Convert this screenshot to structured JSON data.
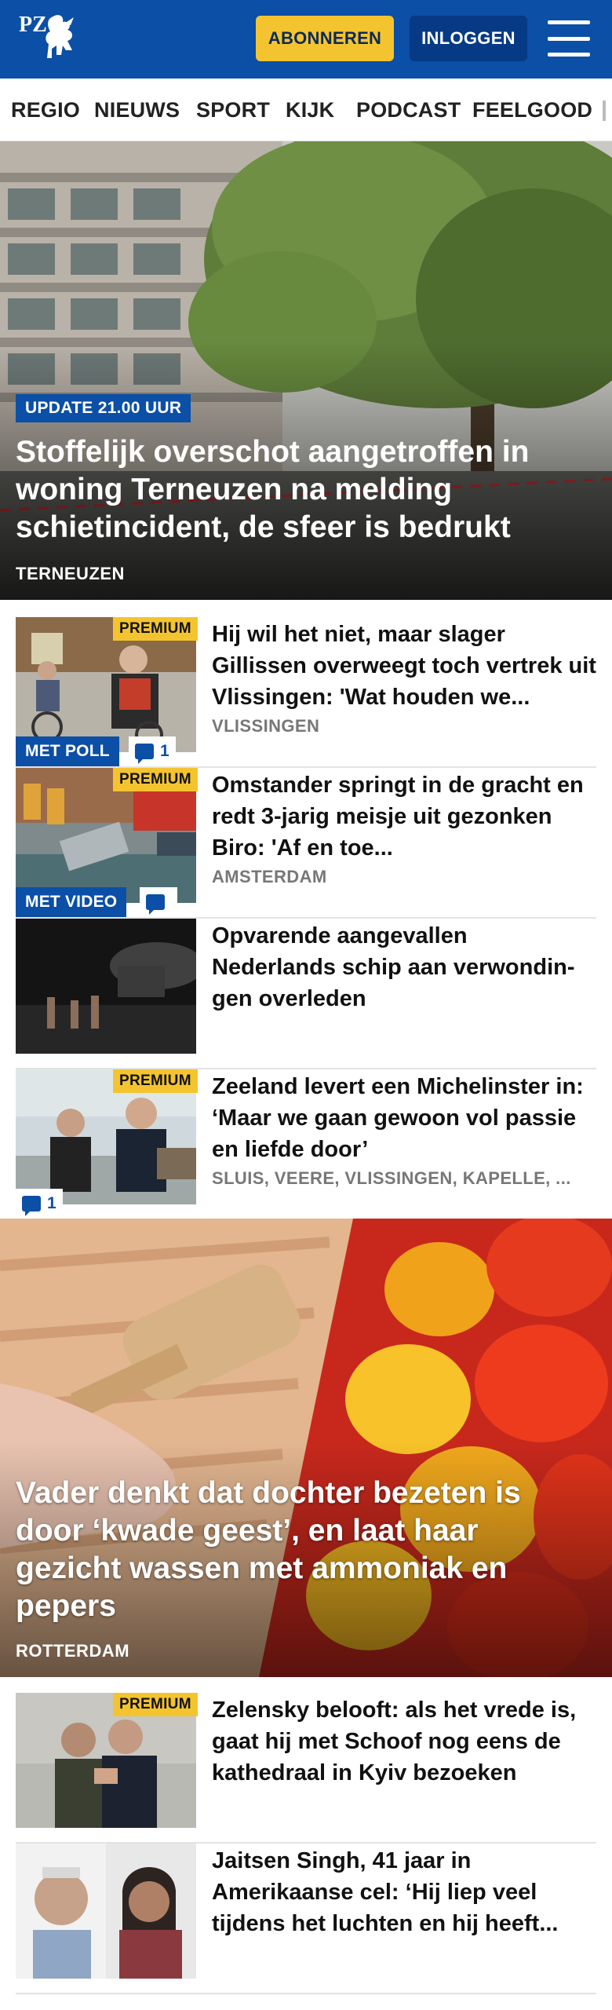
{
  "header": {
    "logo_text": "PZC",
    "subscribe_label": "ABONNEREN",
    "login_label": "INLOGGEN",
    "menu_icon": "hamburger-icon",
    "brand_color": "#0b4fa6",
    "accent_color": "#f4c430"
  },
  "nav": {
    "items": [
      "REGIO",
      "NIEUWS",
      "SPORT",
      "KIJK",
      "PODCAST",
      "FEELGOOD"
    ]
  },
  "hero": {
    "badge": "UPDATE 21.00 UUR",
    "title": "Stoffelijk overschot aangetroffen in woning Terneuzen na melding schietincident, de sfeer is bedrukt",
    "location": "TERNEUZEN"
  },
  "articles": [
    {
      "premium": "PREMIUM",
      "tag": "MET POLL",
      "comments": "1",
      "title": "Hij wil het niet, maar slager Gillissen overweegt toch vertrek uit Vlissingen: 'Wat houden we...",
      "location": "VLISSINGEN"
    },
    {
      "premium": "PREMIUM",
      "tag": "MET VIDEO",
      "comments": "",
      "title": "Omstander springt in de gracht en redt 3-jarig meisje uit gezonken Biro: 'Af en toe...",
      "location": "AMSTERDAM"
    },
    {
      "title": "Opvarende aangevallen Nederlands schip aan verwondin-gen overleden"
    },
    {
      "premium": "PREMIUM",
      "comments": "1",
      "title": "Zeeland levert een Michelinster in: ‘Maar we gaan gewoon vol passie en liefde door’",
      "location": "SLUIS, VEERE, VLISSINGEN, KAPELLE, ..."
    }
  ],
  "feature": {
    "title": "Vader denkt dat dochter bezeten is door ‘kwade geest’, en laat haar gezicht wassen met ammoniak en pepers",
    "location": "ROTTERDAM"
  },
  "articles2": [
    {
      "premium": "PREMIUM",
      "title": "Zelensky belooft: als het vrede is, gaat hij met Schoof nog eens de kathedraal in Kyiv bezoeken"
    },
    {
      "title": "Jaitsen Singh, 41 jaar in Amerikaanse cel: ‘Hij liep veel tijdens het luchten en hij heeft..."
    }
  ]
}
